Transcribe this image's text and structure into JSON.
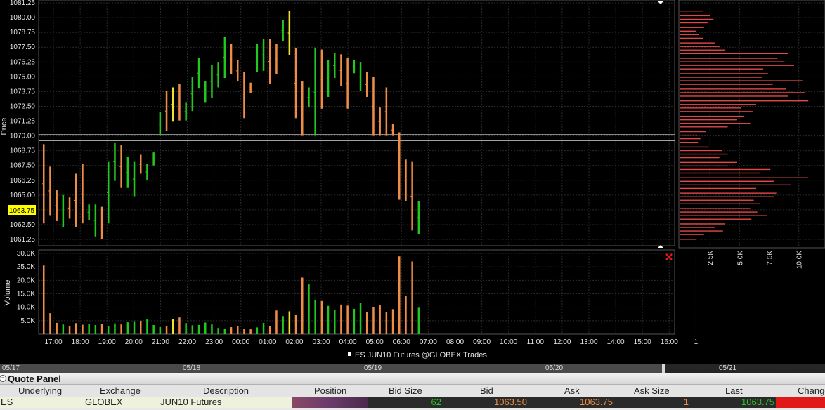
{
  "chart_data": [
    {
      "type": "ohlc",
      "title": "ES JUN10 Futures @GLOBEX Trades",
      "ylabel": "Price",
      "ylim": [
        1060.4,
        1081.25
      ],
      "y_ticks": [
        "1081.25",
        "1080.00",
        "1078.75",
        "1077.50",
        "1076.25",
        "1075.00",
        "1073.75",
        "1072.50",
        "1071.25",
        "1070.00",
        "1068.75",
        "1067.50",
        "1066.25",
        "1065.00",
        "1063.75",
        "1062.50",
        "1061.25"
      ],
      "x_ticks": [
        "17:00",
        "18:00",
        "19:00",
        "20:00",
        "21:00",
        "22:00",
        "23:00",
        "00:00",
        "01:00",
        "02:00",
        "03:00",
        "04:00",
        "05:00",
        "06:00",
        "07:00",
        "08:00",
        "09:00",
        "10:00",
        "11:00",
        "12:00",
        "13:00",
        "14:00",
        "15:00",
        "16:00",
        "1"
      ],
      "last_price": "1063.75",
      "reference_lines": [
        1070.1,
        1069.6
      ],
      "bars": [
        [
          1069.3,
          1062.6,
          "orange"
        ],
        [
          1067.4,
          1063.3,
          "orange"
        ],
        [
          1065.4,
          1062.8,
          "orange"
        ],
        [
          1065.0,
          1062.3,
          "green"
        ],
        [
          1064.8,
          1063.0,
          "orange"
        ],
        [
          1066.8,
          1062.3,
          "orange"
        ],
        [
          1067.6,
          1062.6,
          "orange"
        ],
        [
          1064.2,
          1062.9,
          "green"
        ],
        [
          1064.2,
          1061.5,
          "green"
        ],
        [
          1064.0,
          1061.3,
          "orange"
        ],
        [
          1067.8,
          1062.6,
          "green"
        ],
        [
          1069.4,
          1066.2,
          "green"
        ],
        [
          1069.2,
          1065.6,
          "orange"
        ],
        [
          1068.2,
          1065.6,
          "green"
        ],
        [
          1067.8,
          1064.9,
          "green"
        ],
        [
          1068.4,
          1066.8,
          "orange"
        ],
        [
          1067.6,
          1066.3,
          "green"
        ],
        [
          1068.6,
          1067.5,
          "green"
        ],
        [
          1072.0,
          1070.0,
          "green"
        ],
        [
          1073.8,
          1070.4,
          "orange"
        ],
        [
          1074.1,
          1071.2,
          "yellow"
        ],
        [
          1074.4,
          1071.3,
          "orange"
        ],
        [
          1072.8,
          1071.3,
          "green"
        ],
        [
          1075.0,
          1072.1,
          "green"
        ],
        [
          1076.6,
          1074.0,
          "green"
        ],
        [
          1074.6,
          1072.8,
          "green"
        ],
        [
          1076.0,
          1073.2,
          "green"
        ],
        [
          1076.2,
          1074.1,
          "green"
        ],
        [
          1078.4,
          1074.9,
          "green"
        ],
        [
          1077.8,
          1075.2,
          "orange"
        ],
        [
          1076.4,
          1074.6,
          "orange"
        ],
        [
          1075.4,
          1071.5,
          "orange"
        ],
        [
          1074.5,
          1073.6,
          "orange"
        ],
        [
          1077.8,
          1075.4,
          "green"
        ],
        [
          1078.2,
          1075.5,
          "green"
        ],
        [
          1078.2,
          1074.4,
          "orange"
        ],
        [
          1077.8,
          1075.2,
          "orange"
        ],
        [
          1079.8,
          1078.0,
          "green"
        ],
        [
          1080.6,
          1076.8,
          "yellow"
        ],
        [
          1077.4,
          1071.5,
          "orange"
        ],
        [
          1074.6,
          1070.0,
          "orange"
        ],
        [
          1074.1,
          1072.4,
          "green"
        ],
        [
          1077.4,
          1070.0,
          "green"
        ],
        [
          1077.3,
          1072.3,
          "orange"
        ],
        [
          1076.4,
          1073.3,
          "green"
        ],
        [
          1077.0,
          1074.9,
          "green"
        ],
        [
          1076.9,
          1074.2,
          "orange"
        ],
        [
          1076.6,
          1072.3,
          "orange"
        ],
        [
          1076.4,
          1075.3,
          "green"
        ],
        [
          1076.2,
          1073.8,
          "green"
        ],
        [
          1075.4,
          1073.3,
          "orange"
        ],
        [
          1075.0,
          1070.0,
          "orange"
        ],
        [
          1072.4,
          1070.0,
          "orange"
        ],
        [
          1074.1,
          1070.0,
          "orange"
        ],
        [
          1071.0,
          1070.0,
          "orange"
        ],
        [
          1070.3,
          1064.6,
          "orange"
        ],
        [
          1068.0,
          1064.5,
          "orange"
        ],
        [
          1067.8,
          1062.0,
          "orange"
        ],
        [
          1064.5,
          1061.7,
          "green"
        ]
      ],
      "volume": {
        "ylabel": "Volume",
        "ylim": [
          0,
          30000
        ],
        "y_ticks": [
          "30.0K",
          "25.0K",
          "20.0K",
          "15.0K",
          "10.0K",
          "5.0K"
        ],
        "values": [
          25500,
          7800,
          4200,
          3600,
          3000,
          4100,
          3500,
          3800,
          3400,
          3700,
          3100,
          4000,
          3600,
          4400,
          4800,
          5000,
          5600,
          3400,
          2600,
          3000,
          5500,
          6200,
          4100,
          3300,
          3400,
          4300,
          3600,
          2300,
          1900,
          2600,
          2900,
          2000,
          1800,
          2500,
          4200,
          3100,
          8800,
          6700,
          8500,
          7200,
          21000,
          18500,
          12800,
          12300,
          10500,
          8900,
          11000,
          10600,
          9400,
          11500,
          8300,
          10000,
          10800,
          8300,
          9300,
          28900,
          14200,
          27000,
          9800
        ]
      },
      "profile": {
        "x_ticks": [
          "2.5K",
          "5.0K",
          "7.5K",
          "10.0K"
        ],
        "xlim": [
          0,
          11500
        ],
        "bins": [
          [
            1080.6,
            1900
          ],
          [
            1080.2,
            2500
          ],
          [
            1079.9,
            2800
          ],
          [
            1079.6,
            2300
          ],
          [
            1079.2,
            2000
          ],
          [
            1078.9,
            1300
          ],
          [
            1078.6,
            1600
          ],
          [
            1078.3,
            1900
          ],
          [
            1077.9,
            2900
          ],
          [
            1077.6,
            3300
          ],
          [
            1077.3,
            3800
          ],
          [
            1077.0,
            9100
          ],
          [
            1076.6,
            8200
          ],
          [
            1076.3,
            8800
          ],
          [
            1076.0,
            9600
          ],
          [
            1075.7,
            7000
          ],
          [
            1075.3,
            7400
          ],
          [
            1075.0,
            6900
          ],
          [
            1074.7,
            10300
          ],
          [
            1074.4,
            7800
          ],
          [
            1074.0,
            8900
          ],
          [
            1073.7,
            10500
          ],
          [
            1073.4,
            9100
          ],
          [
            1073.0,
            10800
          ],
          [
            1072.7,
            6400
          ],
          [
            1072.4,
            5100
          ],
          [
            1072.1,
            6100
          ],
          [
            1071.7,
            5400
          ],
          [
            1071.4,
            4800
          ],
          [
            1071.1,
            5900
          ],
          [
            1070.8,
            4000
          ],
          [
            1070.4,
            2200
          ],
          [
            1070.1,
            1500
          ],
          [
            1069.8,
            1700
          ],
          [
            1069.5,
            1500
          ],
          [
            1069.1,
            2400
          ],
          [
            1068.8,
            3500
          ],
          [
            1068.5,
            4000
          ],
          [
            1068.2,
            3300
          ],
          [
            1067.8,
            4800
          ],
          [
            1067.5,
            4000
          ],
          [
            1067.2,
            7600
          ],
          [
            1066.9,
            6700
          ],
          [
            1066.5,
            10800
          ],
          [
            1066.2,
            7900
          ],
          [
            1065.9,
            9300
          ],
          [
            1065.6,
            6400
          ],
          [
            1065.2,
            8100
          ],
          [
            1064.9,
            7900
          ],
          [
            1064.6,
            6200
          ],
          [
            1064.3,
            6700
          ],
          [
            1063.9,
            5900
          ],
          [
            1063.6,
            6500
          ],
          [
            1063.3,
            7300
          ],
          [
            1063.0,
            6000
          ],
          [
            1062.6,
            3800
          ],
          [
            1062.3,
            2900
          ],
          [
            1062.0,
            3600
          ],
          [
            1061.7,
            2000
          ],
          [
            1061.3,
            1300
          ]
        ]
      }
    }
  ],
  "timeline": {
    "dates": [
      "05/17",
      "05/18",
      "05/19",
      "05/20",
      "05/21"
    ]
  },
  "quote_panel": {
    "title": "Quote Panel",
    "columns": [
      "Underlying",
      "Exchange",
      "Description",
      "Position",
      "Bid Size",
      "Bid",
      "Ask",
      "Ask Size",
      "Last",
      "Change"
    ],
    "row": {
      "underlying": "ES",
      "exchange": "GLOBEX",
      "description": "JUN10 Futures",
      "position": "",
      "bid_size": "62",
      "bid": "1063.50",
      "ask": "1063.75",
      "ask_size": "1",
      "last": "1063.75",
      "change": ""
    }
  },
  "colors": {
    "up": "#22c81e",
    "down": "#f08c46",
    "neutral": "#f0e030",
    "profile": "#e04848",
    "grid": "#2a2a2a",
    "axis_text": "#e6e6e6",
    "last_price_bg": "#ffff00",
    "close_icon": "#e01818"
  }
}
